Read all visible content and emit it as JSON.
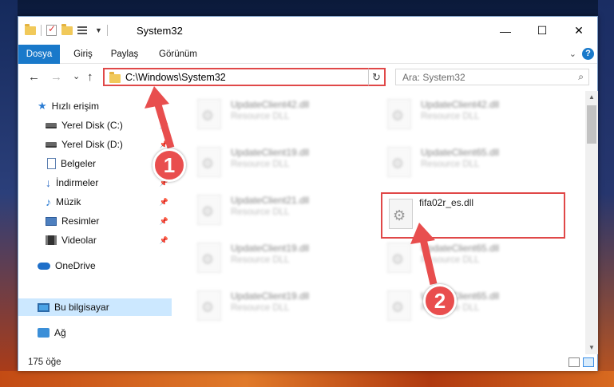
{
  "window": {
    "title": "System32",
    "controls": {
      "minimize": "—",
      "maximize": "☐",
      "close": "✕"
    }
  },
  "ribbon": {
    "tabs": [
      "Dosya",
      "Giriş",
      "Paylaş",
      "Görünüm"
    ],
    "collapse_icon": "chevron-down-icon",
    "help": "?"
  },
  "navigation": {
    "back": "←",
    "forward": "→",
    "recent": "⌄",
    "up": "↑",
    "address_path": "C:\\Windows\\System32",
    "refresh": "↻",
    "search_placeholder": "Ara: System32"
  },
  "sidebar": {
    "items": [
      {
        "label": "Hızlı erişim",
        "icon": "star-icon",
        "pinned": false
      },
      {
        "label": "Yerel Disk (C:)",
        "icon": "disk-icon",
        "pinned": true
      },
      {
        "label": "Yerel Disk (D:)",
        "icon": "disk-icon",
        "pinned": true
      },
      {
        "label": "Belgeler",
        "icon": "document-icon",
        "pinned": true
      },
      {
        "label": "İndirmeler",
        "icon": "download-icon",
        "pinned": true
      },
      {
        "label": "Müzik",
        "icon": "music-icon",
        "pinned": true
      },
      {
        "label": "Resimler",
        "icon": "pictures-icon",
        "pinned": true
      },
      {
        "label": "Videolar",
        "icon": "videos-icon",
        "pinned": true
      },
      {
        "label": "OneDrive",
        "icon": "cloud-icon",
        "pinned": false
      },
      {
        "label": "Bu bilgisayar",
        "icon": "computer-icon",
        "pinned": false,
        "selected": true
      },
      {
        "label": "Ağ",
        "icon": "network-icon",
        "pinned": false
      }
    ]
  },
  "files": [
    {
      "name": "UpdateClient42.dll",
      "type": "Resource DLL"
    },
    {
      "name": "UpdateClient42.dll",
      "type": "Resource DLL"
    },
    {
      "name": "UpdateClient19.dll",
      "type": "Resource DLL"
    },
    {
      "name": "UpdateClient65.dll",
      "type": "Resource DLL"
    },
    {
      "name": "UpdateClient21.dll",
      "type": "Resource DLL"
    },
    {
      "name": "fifa02r_es.dll",
      "type": ""
    },
    {
      "name": "UpdateClient19.dll",
      "type": "Resource DLL"
    },
    {
      "name": "UpdateClient65.dll",
      "type": "Resource DLL"
    },
    {
      "name": "UpdateClient19.dll",
      "type": "Resource DLL"
    },
    {
      "name": "UpdateClient65.dll",
      "type": "Resource DLL"
    }
  ],
  "status": {
    "item_count": "175 öğe"
  },
  "annotations": {
    "step1": "1",
    "step2": "2",
    "color": "#e84e4e"
  }
}
